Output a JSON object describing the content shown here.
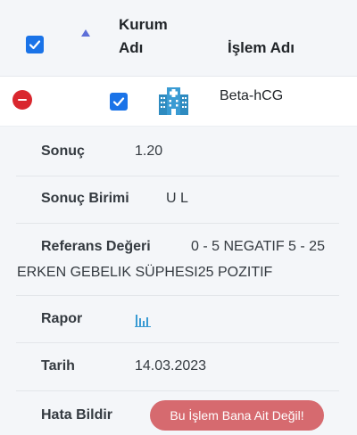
{
  "header": {
    "col_kurum_line1": "Kurum",
    "col_kurum_line2": "Adı",
    "col_islem": "İşlem Adı"
  },
  "row": {
    "procedure_name": "Beta-hCG"
  },
  "details": {
    "sonuc_label": "Sonuç",
    "sonuc_value": "1.20",
    "birim_label": "Sonuç Birimi",
    "birim_value": "U L",
    "referans_label": "Referans Değeri",
    "referans_value_line1": "0 - 5 NEGATIF 5 - 25",
    "referans_value_line2": "ERKEN GEBELIK SÜPHESI25 POZITIF",
    "rapor_label": "Rapor",
    "tarih_label": "Tarih",
    "tarih_value": "14.03.2023",
    "hata_label": "Hata Bildir",
    "hata_button": "Bu İşlem Bana Ait Değil!"
  },
  "colors": {
    "checkbox": "#1a73e8",
    "minus_button": "#d9272e",
    "report_button": "#d66a6f",
    "building_icon": "#2e8bc0"
  },
  "icons": [
    "check-icon",
    "sort-asc-icon",
    "minus-icon",
    "hospital-building-icon",
    "bar-chart-icon"
  ]
}
